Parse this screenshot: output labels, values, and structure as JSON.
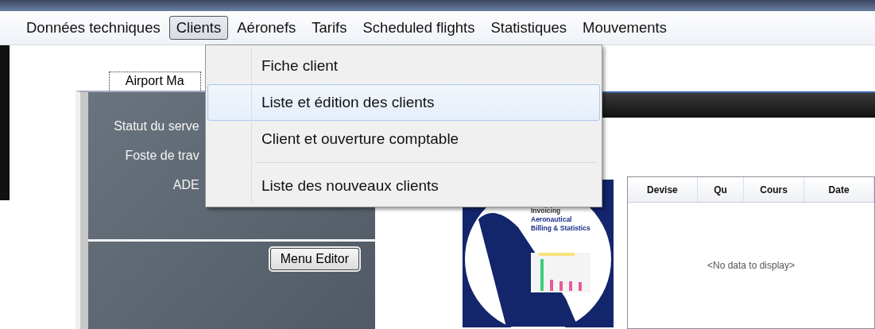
{
  "menu_bar": {
    "items": [
      {
        "label": "Données techniques",
        "selected": false
      },
      {
        "label": "Clients",
        "selected": true
      },
      {
        "label": "Aéronefs",
        "selected": false
      },
      {
        "label": "Tarifs",
        "selected": false
      },
      {
        "label": "Scheduled flights",
        "selected": false
      },
      {
        "label": "Statistiques",
        "selected": false
      },
      {
        "label": "Mouvements",
        "selected": false
      }
    ]
  },
  "dropdown": {
    "items": [
      {
        "kind": "item",
        "label": "Fiche client",
        "selected": false
      },
      {
        "kind": "item",
        "label": "Liste et édition des clients",
        "selected": true
      },
      {
        "kind": "item",
        "label": "Client et ouverture comptable",
        "selected": false
      },
      {
        "kind": "separator"
      },
      {
        "kind": "item",
        "label": "Liste des nouveaux clients",
        "selected": false
      }
    ]
  },
  "tab": {
    "label": "Airport Ma"
  },
  "status_panel": {
    "lines": [
      "Statut du serve",
      "Foste de trav",
      "ADE"
    ],
    "button": "Menu Editor"
  },
  "logo": {
    "lines": [
      "Invoicing",
      "Aeronautical",
      "Billing & Statistics"
    ]
  },
  "table": {
    "columns": [
      "Devise",
      "Qu",
      "Cours",
      "Date"
    ],
    "empty_text": "<No data to display>"
  }
}
